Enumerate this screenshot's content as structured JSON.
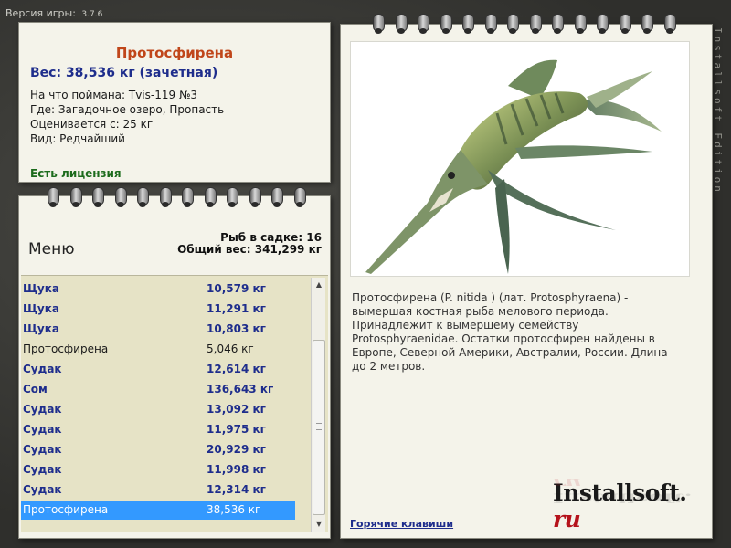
{
  "version": {
    "label": "Версия игры:",
    "number": "3.7.6"
  },
  "fish_info": {
    "name": "Протосфирена",
    "weight": "Вес: 38,536 кг (зачетная)",
    "caught_on": "На что поймана: Tvis-119 №3",
    "location": "Где: Загадочное озеро, Пропасть",
    "valued_from": "Оценивается с: 25 кг",
    "kind": "Вид: Редчайший",
    "license": "Есть лицензия"
  },
  "cage": {
    "menu_label": "Меню",
    "fish_count": "Рыб в садке: 16",
    "total_weight": "Общий вес: 341,299 кг",
    "rows": [
      {
        "name": "Щука",
        "weight": "10,579 кг",
        "style": "bold"
      },
      {
        "name": "Щука",
        "weight": "11,291 кг",
        "style": "bold"
      },
      {
        "name": "Щука",
        "weight": "10,803 кг",
        "style": "bold"
      },
      {
        "name": "Протосфирена",
        "weight": "5,046 кг",
        "style": "plain"
      },
      {
        "name": "Судак",
        "weight": "12,614 кг",
        "style": "bold"
      },
      {
        "name": "Сом",
        "weight": "136,643 кг",
        "style": "bold"
      },
      {
        "name": "Судак",
        "weight": "13,092 кг",
        "style": "bold"
      },
      {
        "name": "Судак",
        "weight": "11,975 кг",
        "style": "bold"
      },
      {
        "name": "Судак",
        "weight": "20,929 кг",
        "style": "bold"
      },
      {
        "name": "Судак",
        "weight": "11,998 кг",
        "style": "bold"
      },
      {
        "name": "Судак",
        "weight": "12,314 кг",
        "style": "bold"
      },
      {
        "name": "Протосфирена",
        "weight": "38,536 кг",
        "style": "selected"
      }
    ]
  },
  "detail": {
    "description": "Протосфирена (P. nitida ) (лат. Protosphyraena) - вымершая костная рыба мелового периода. Принадлежит к вымершему семейству Protosphyraenidae. Остатки протосфирен найдены в Европе, Северной Америки, Австралии, России. Длина до 2 метров.",
    "hotkeys_link": "Горячие клавиши",
    "brand_main": "Installsoft.",
    "brand_suffix": "ru"
  },
  "watermark": "Installsoft Edition",
  "colors": {
    "title": "#c0461a",
    "accent_blue": "#1e2d8c",
    "license_green": "#1c6b1c",
    "selection": "#3399ff",
    "list_bg": "#e6e3c6"
  }
}
